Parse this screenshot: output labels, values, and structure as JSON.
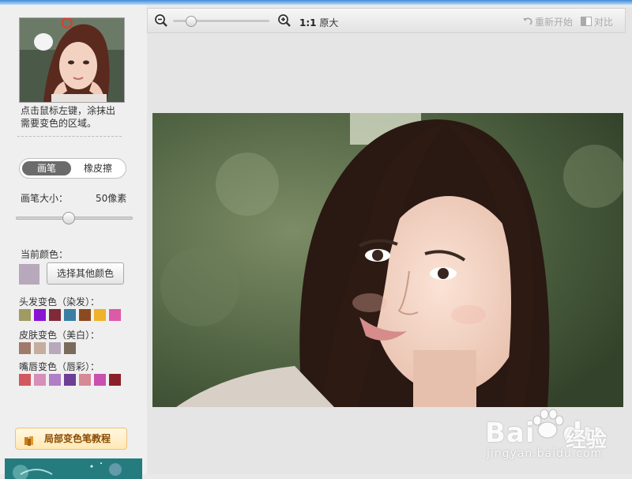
{
  "sidebar": {
    "hint_line1": "点击鼠标左键，涂抹出",
    "hint_line2": "需要变色的区域。",
    "mode_brush": "画笔",
    "mode_eraser": "橡皮擦",
    "brush_size_label": "画笔大小：",
    "brush_size_value": "50像素",
    "brush_size_level": 0.45,
    "current_color_label": "当前颜色：",
    "current_color": "#b7a9bb",
    "choose_color_button": "选择其他颜色",
    "hair_label": "头发变色（染发）：",
    "hair_colors": [
      "#9f9c61",
      "#8a12d2",
      "#7f2a36",
      "#3a7ea4",
      "#8b4a1f",
      "#efb22a",
      "#dd5aa7"
    ],
    "skin_label": "皮肤变色（美白）：",
    "skin_colors": [
      "#a07a6b",
      "#c5aea0",
      "#b7a9bb",
      "#7b6b5c"
    ],
    "lip_label": "嘴唇变色（唇彩）：",
    "lip_colors": [
      "#d2575f",
      "#d58fb8",
      "#b07dc6",
      "#6c3f94",
      "#d58a96",
      "#c950b0",
      "#8a1f2a"
    ],
    "tutorial_button": "局部变色笔教程"
  },
  "toolbar": {
    "zoom_level": 0.15,
    "ratio_bold": "1:1",
    "ratio_text": "原大",
    "restart": "重新开始",
    "compare": "对比"
  },
  "watermark": {
    "logo": "Bai",
    "logo2": "du",
    "cn": "经验",
    "url": "jingyan.baidu.com"
  }
}
